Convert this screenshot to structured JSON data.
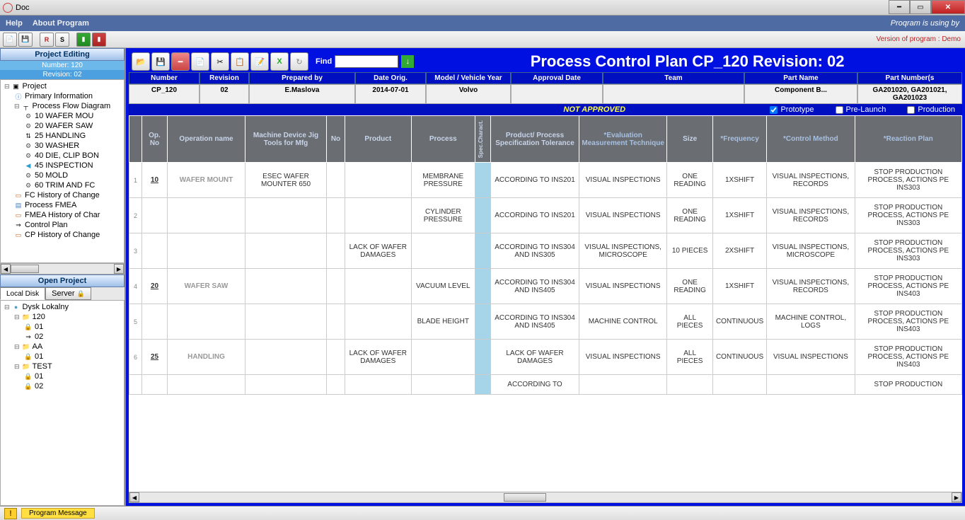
{
  "window": {
    "title": "Doc"
  },
  "menubar": {
    "help": "Help",
    "about": "About Program",
    "using_by": "Proqram is using by"
  },
  "toolbar_right": "Version of program : Demo",
  "left": {
    "panel_hdr": "Project Editing",
    "number_line": "Number: 120",
    "revision_line": "Revision: 02",
    "project_tree": [
      {
        "ind": 0,
        "ico": "▣",
        "txt": "Project",
        "exp": "⊟"
      },
      {
        "ind": 1,
        "ico": "ⓘ",
        "txt": "Primary Information",
        "col": "#2070d0"
      },
      {
        "ind": 1,
        "ico": "┬",
        "txt": "Process Flow Diagram",
        "exp": "⊟"
      },
      {
        "ind": 2,
        "ico": "⚙",
        "txt": "10 WAFER MOU"
      },
      {
        "ind": 2,
        "ico": "⚙",
        "txt": "20 WAFER SAW"
      },
      {
        "ind": 2,
        "ico": "⇅",
        "txt": "25 HANDLING"
      },
      {
        "ind": 2,
        "ico": "⚙",
        "txt": "30 WASHER"
      },
      {
        "ind": 2,
        "ico": "⚙",
        "txt": "40 DIE, CLIP BON"
      },
      {
        "ind": 2,
        "ico": "◀",
        "txt": "45 INSPECTION",
        "col": "#30a0d0"
      },
      {
        "ind": 2,
        "ico": "⚙",
        "txt": "50 MOLD"
      },
      {
        "ind": 2,
        "ico": "⚙",
        "txt": "60 TRIM AND FC"
      },
      {
        "ind": 1,
        "ico": "▭",
        "txt": "FC History of Change",
        "col": "#c06020"
      },
      {
        "ind": 1,
        "ico": "▤",
        "txt": "Process FMEA",
        "col": "#4080c0"
      },
      {
        "ind": 1,
        "ico": "▭",
        "txt": "FMEA History of Char",
        "col": "#c06020"
      },
      {
        "ind": 1,
        "ico": "⇒",
        "txt": "Control Plan"
      },
      {
        "ind": 1,
        "ico": "▭",
        "txt": "CP History of Change",
        "col": "#c06020"
      }
    ],
    "open_hdr": "Open Project",
    "tabs": {
      "local": "Local Disk",
      "server": "Server"
    },
    "disk_tree": [
      {
        "ind": 0,
        "ico": "●",
        "txt": "Dysk Lokalny",
        "exp": "⊟",
        "col": "#50a0d0"
      },
      {
        "ind": 1,
        "ico": "📁",
        "txt": "120",
        "exp": "⊟"
      },
      {
        "ind": 2,
        "ico": "🔒",
        "txt": "01",
        "col": "#c02020"
      },
      {
        "ind": 2,
        "ico": "⇒",
        "txt": "02"
      },
      {
        "ind": 1,
        "ico": "📁",
        "txt": "AA",
        "exp": "⊟"
      },
      {
        "ind": 2,
        "ico": "🔒",
        "txt": "01",
        "col": "#c02020"
      },
      {
        "ind": 1,
        "ico": "📁",
        "txt": "TEST",
        "exp": "⊟"
      },
      {
        "ind": 2,
        "ico": "🔒",
        "txt": "01",
        "col": "#c02020"
      },
      {
        "ind": 2,
        "ico": "🔒",
        "txt": "02",
        "col": "#c02020"
      }
    ]
  },
  "doc": {
    "find_label": "Find",
    "title": "Process Control Plan CP_120 Revision: 02",
    "info_hdrs": [
      "Number",
      "Revision",
      "Prepared by",
      "Date Orig.",
      "Model / Vehicle Year",
      "Approval Date",
      "Team",
      "Part Name",
      "Part Number(s"
    ],
    "info_vals": [
      "CP_120",
      "02",
      "E.Maslova",
      "2014-07-01",
      "Volvo",
      "",
      "",
      "Component B...",
      "GA201020, GA201021, GA201023"
    ],
    "not_approved": "NOT APPROVED",
    "phases": {
      "proto": "Prototype",
      "pre": "Pre-Launch",
      "prod": "Production"
    },
    "grid_hdrs": [
      "",
      "Op. No",
      "Operation name",
      "Machine Device Jig Tools for Mfg",
      "No",
      "Product",
      "Process",
      "Spec.Charact.",
      "Product/ Process Specification Tolerance",
      "*Evaluation Measurement Technique",
      "Size",
      "*Frequency",
      "*Control Method",
      "*Reaction Plan"
    ],
    "rows": [
      {
        "idx": "1",
        "op": "10",
        "name": "WAFER MOUNT",
        "mach": "ESEC WAFER MOUNTER 650",
        "no": "",
        "prod": "",
        "proc": "MEMBRANE PRESSURE",
        "tol": "ACCORDING TO INS201",
        "eval": "VISUAL INSPECTIONS",
        "size": "ONE READING",
        "freq": "1XSHIFT",
        "ctrl": "VISUAL INSPECTIONS, RECORDS",
        "react": "STOP PRODUCTION PROCESS, ACTIONS PE INS303"
      },
      {
        "idx": "2",
        "op": "",
        "name": "",
        "mach": "",
        "no": "",
        "prod": "",
        "proc": "CYLINDER PRESSURE",
        "tol": "ACCORDING TO INS201",
        "eval": "VISUAL INSPECTIONS",
        "size": "ONE READING",
        "freq": "1XSHIFT",
        "ctrl": "VISUAL INSPECTIONS, RECORDS",
        "react": "STOP PRODUCTION PROCESS, ACTIONS PE INS303"
      },
      {
        "idx": "3",
        "op": "",
        "name": "",
        "mach": "",
        "no": "",
        "prod": "LACK OF WAFER DAMAGES",
        "proc": "",
        "tol": "ACCORDING TO INS304 AND INS305",
        "eval": "VISUAL INSPECTIONS, MICROSCOPE",
        "size": "10 PIECES",
        "freq": "2XSHIFT",
        "ctrl": "VISUAL INSPECTIONS, MICROSCOPE",
        "react": "STOP PRODUCTION PROCESS, ACTIONS PE INS303"
      },
      {
        "idx": "4",
        "op": "20",
        "name": "WAFER SAW",
        "mach": "",
        "no": "",
        "prod": "",
        "proc": "VACUUM LEVEL",
        "tol": "ACCORDING TO INS304 AND INS405",
        "eval": "VISUAL INSPECTIONS",
        "size": "ONE READING",
        "freq": "1XSHIFT",
        "ctrl": "VISUAL INSPECTIONS, RECORDS",
        "react": "STOP PRODUCTION PROCESS, ACTIONS PE INS403"
      },
      {
        "idx": "5",
        "op": "",
        "name": "",
        "mach": "",
        "no": "",
        "prod": "",
        "proc": "BLADE HEIGHT",
        "tol": "ACCORDING TO INS304 AND INS405",
        "eval": "MACHINE CONTROL",
        "size": "ALL PIECES",
        "freq": "CONTINUOUS",
        "ctrl": "MACHINE CONTROL, LOGS",
        "react": "STOP PRODUCTION PROCESS, ACTIONS PE INS403"
      },
      {
        "idx": "6",
        "op": "25",
        "name": "HANDLING",
        "mach": "",
        "no": "",
        "prod": "LACK OF WAFER DAMAGES",
        "proc": "",
        "tol": "LACK OF WAFER DAMAGES",
        "eval": "VISUAL INSPECTIONS",
        "size": "ALL PIECES",
        "freq": "CONTINUOUS",
        "ctrl": "VISUAL INSPECTIONS",
        "react": "STOP PRODUCTION PROCESS, ACTIONS PE INS403"
      },
      {
        "idx": "",
        "op": "",
        "name": "",
        "mach": "",
        "no": "",
        "prod": "",
        "proc": "",
        "tol": "ACCORDING TO",
        "eval": "",
        "size": "",
        "freq": "",
        "ctrl": "",
        "react": "STOP PRODUCTION"
      }
    ]
  },
  "bottom": {
    "program_message": "Program Message"
  }
}
